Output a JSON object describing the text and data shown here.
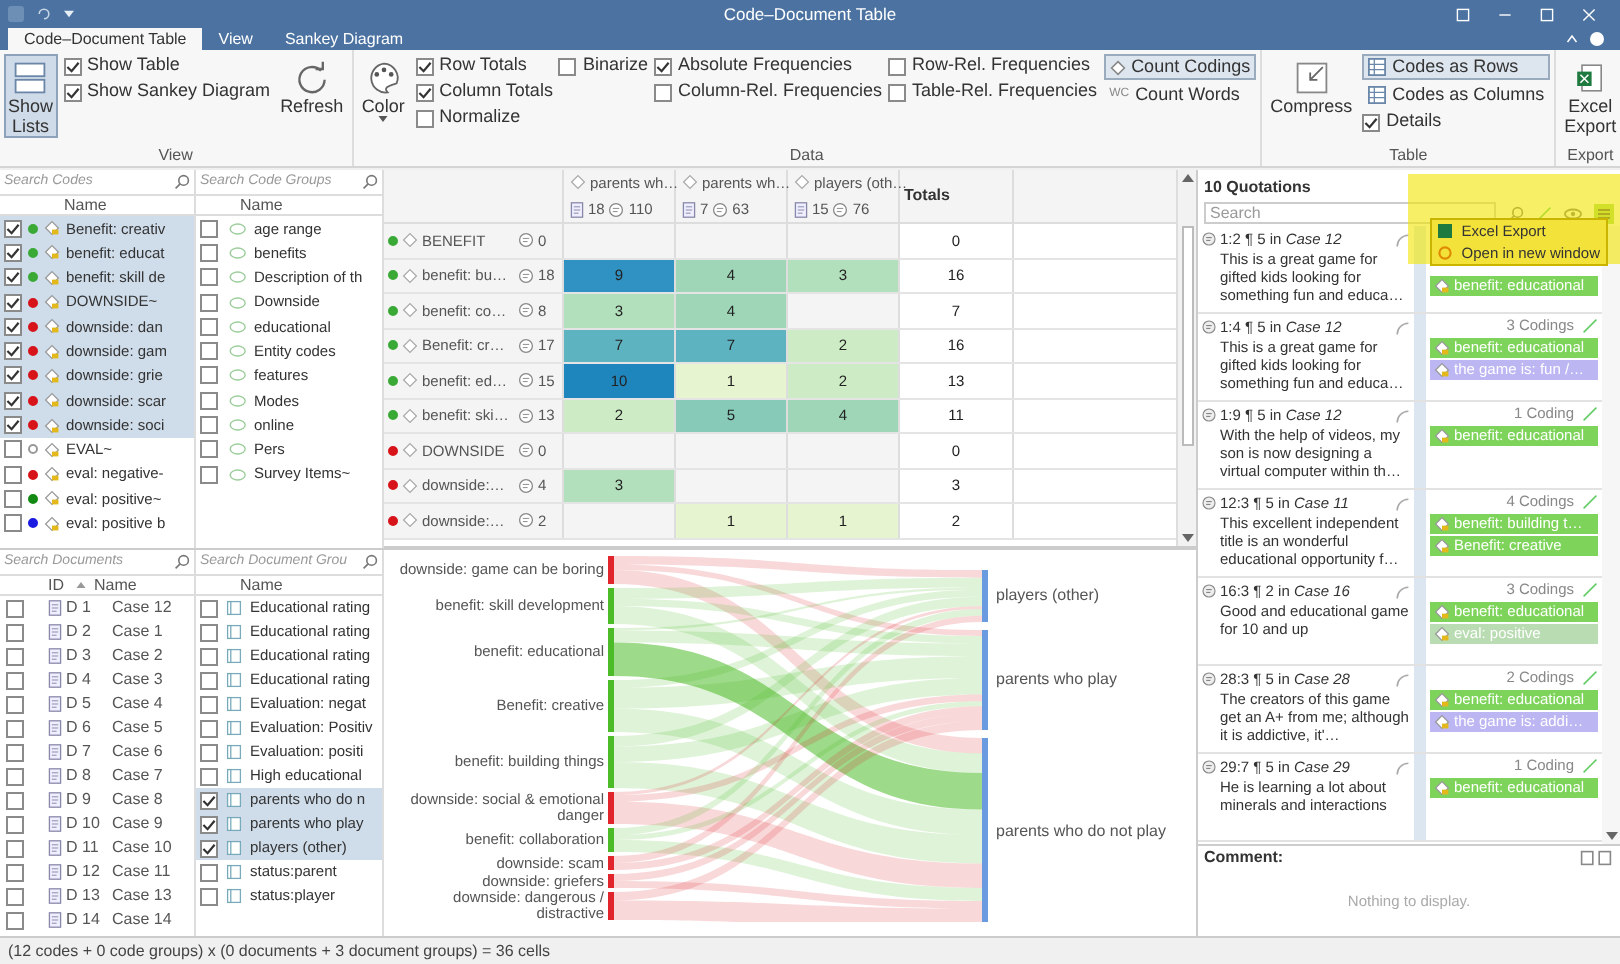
{
  "window": {
    "title": "Code–Document Table"
  },
  "tabs": [
    {
      "label": "Code–Document Table",
      "selected": true
    },
    {
      "label": "View",
      "selected": false
    },
    {
      "label": "Sankey Diagram",
      "selected": false
    }
  ],
  "ribbon": [
    {
      "label": "View",
      "columns": [
        [
          {
            "kind": "lists",
            "label": "Show Lists",
            "selected": true
          }
        ],
        [
          {
            "kind": "check",
            "label": "Show Table",
            "checked": true
          },
          {
            "kind": "check",
            "label": "Show Sankey Diagram",
            "checked": true
          }
        ],
        [
          {
            "kind": "refresh",
            "label": "Refresh"
          }
        ]
      ]
    },
    {
      "label": "Data",
      "columns": [
        [
          {
            "kind": "color",
            "label": "Color"
          }
        ],
        [
          {
            "kind": "check",
            "label": "Row Totals",
            "checked": true
          },
          {
            "kind": "check",
            "label": "Column Totals",
            "checked": true
          },
          {
            "kind": "check",
            "label": "Normalize",
            "checked": false
          }
        ],
        [
          {
            "kind": "check",
            "label": "Binarize",
            "checked": false
          }
        ],
        [
          {
            "kind": "check",
            "label": "Absolute Frequencies",
            "checked": true
          },
          {
            "kind": "check",
            "label": "Column-Rel. Frequencies",
            "checked": false
          }
        ],
        [
          {
            "kind": "check",
            "label": "Row-Rel. Frequencies",
            "checked": false
          },
          {
            "kind": "check",
            "label": "Table-Rel. Frequencies",
            "checked": false
          }
        ],
        [
          {
            "kind": "codings",
            "label": "Count Codings",
            "selected": true
          },
          {
            "kind": "words",
            "label": "Count Words",
            "badge": "WC",
            "selected": false
          }
        ]
      ]
    },
    {
      "label": "Table",
      "columns": [
        [
          {
            "kind": "compress",
            "label": "Compress"
          }
        ],
        [
          {
            "kind": "rows",
            "label": "Codes as Rows",
            "selected": true
          },
          {
            "kind": "columns",
            "label": "Codes as Columns",
            "selected": false
          },
          {
            "kind": "check",
            "label": "Details",
            "checked": true
          }
        ]
      ]
    },
    {
      "label": "Export",
      "columns": [
        [
          {
            "kind": "excel",
            "label": "Excel Export"
          }
        ]
      ]
    }
  ],
  "codes": {
    "search_placeholder": "Search Codes",
    "column": "Name",
    "items": [
      {
        "checked": true,
        "selected": true,
        "color": "#3aa935",
        "name": "Benefit: creativ"
      },
      {
        "checked": true,
        "selected": true,
        "color": "#3aa935",
        "name": "benefit: educat"
      },
      {
        "checked": true,
        "selected": true,
        "color": "#3aa935",
        "name": "benefit: skill de"
      },
      {
        "checked": true,
        "selected": true,
        "color": "#d7141a",
        "name": "DOWNSIDE~"
      },
      {
        "checked": true,
        "selected": true,
        "color": "#d7141a",
        "name": "downside: dan"
      },
      {
        "checked": true,
        "selected": true,
        "color": "#d7141a",
        "name": "downside: gam"
      },
      {
        "checked": true,
        "selected": true,
        "color": "#d7141a",
        "name": "downside: grie"
      },
      {
        "checked": true,
        "selected": true,
        "color": "#d7141a",
        "name": "downside: scar"
      },
      {
        "checked": true,
        "selected": true,
        "color": "#d7141a",
        "name": "downside: soci"
      },
      {
        "checked": false,
        "selected": false,
        "color": "#ffffff",
        "name": "EVAL~"
      },
      {
        "checked": false,
        "selected": false,
        "color": "#d7141a",
        "name": "eval: negative-"
      },
      {
        "checked": false,
        "selected": false,
        "color": "#138a13",
        "name": "eval: positive~"
      },
      {
        "checked": false,
        "selected": false,
        "color": "#1a1ae0",
        "name": "eval: positive b"
      }
    ]
  },
  "code_groups": {
    "search_placeholder": "Search Code Groups",
    "column": "Name",
    "items": [
      {
        "checked": false,
        "name": "age range"
      },
      {
        "checked": false,
        "name": "benefits"
      },
      {
        "checked": false,
        "name": "Description of th"
      },
      {
        "checked": false,
        "name": "Downside"
      },
      {
        "checked": false,
        "name": "educational"
      },
      {
        "checked": false,
        "name": "Entity codes"
      },
      {
        "checked": false,
        "name": "features"
      },
      {
        "checked": false,
        "name": "Modes"
      },
      {
        "checked": false,
        "name": "online"
      },
      {
        "checked": false,
        "name": "Pers"
      },
      {
        "checked": false,
        "name": "Survey Items~"
      }
    ]
  },
  "matrix": {
    "columns": [
      {
        "name": "parents wh…",
        "documents": "18",
        "quotations": "110"
      },
      {
        "name": "parents wh…",
        "documents": "7",
        "quotations": "63"
      },
      {
        "name": "players (oth…",
        "documents": "15",
        "quotations": "76"
      }
    ],
    "totals_label": "Totals",
    "rows": [
      {
        "color": "#3aa935",
        "name": "BENEFIT",
        "count": "0",
        "cells": [
          null,
          null,
          null
        ],
        "total": "0"
      },
      {
        "color": "#3aa935",
        "name": "benefit: bu…",
        "count": "18",
        "cells": [
          "9",
          "4",
          "3"
        ],
        "total": "16"
      },
      {
        "color": "#3aa935",
        "name": "benefit: co…",
        "count": "8",
        "cells": [
          "3",
          "4",
          null
        ],
        "total": "7"
      },
      {
        "color": "#3aa935",
        "name": "Benefit: cr…",
        "count": "17",
        "cells": [
          "7",
          "7",
          "2"
        ],
        "total": "16"
      },
      {
        "color": "#3aa935",
        "name": "benefit: ed…",
        "count": "15",
        "cells": [
          "10",
          "1",
          "2"
        ],
        "total": "13"
      },
      {
        "color": "#3aa935",
        "name": "benefit: ski…",
        "count": "13",
        "cells": [
          "2",
          "5",
          "4"
        ],
        "total": "11"
      },
      {
        "color": "#d7141a",
        "name": "DOWNSIDE",
        "count": "0",
        "cells": [
          null,
          null,
          null
        ],
        "total": "0"
      },
      {
        "color": "#d7141a",
        "name": "downside:…",
        "count": "4",
        "cells": [
          "3",
          null,
          null
        ],
        "total": "3"
      },
      {
        "color": "#d7141a",
        "name": "downside:…",
        "count": "2",
        "cells": [
          null,
          "1",
          "1"
        ],
        "total": "2"
      }
    ]
  },
  "documents": {
    "search_placeholder": "Search Documents",
    "columns": [
      "ID",
      "Name"
    ],
    "items": [
      {
        "checked": false,
        "id": "D 1",
        "name": "Case 12"
      },
      {
        "checked": false,
        "id": "D 2",
        "name": "Case 1"
      },
      {
        "checked": false,
        "id": "D 3",
        "name": "Case 2"
      },
      {
        "checked": false,
        "id": "D 4",
        "name": "Case 3"
      },
      {
        "checked": false,
        "id": "D 5",
        "name": "Case 4"
      },
      {
        "checked": false,
        "id": "D 6",
        "name": "Case 5"
      },
      {
        "checked": false,
        "id": "D 7",
        "name": "Case 6"
      },
      {
        "checked": false,
        "id": "D 8",
        "name": "Case 7"
      },
      {
        "checked": false,
        "id": "D 9",
        "name": "Case 8"
      },
      {
        "checked": false,
        "id": "D 10",
        "name": "Case 9"
      },
      {
        "checked": false,
        "id": "D 11",
        "name": "Case 10"
      },
      {
        "checked": false,
        "id": "D 12",
        "name": "Case 11"
      },
      {
        "checked": false,
        "id": "D 13",
        "name": "Case 13"
      },
      {
        "checked": false,
        "id": "D 14",
        "name": "Case 14"
      }
    ]
  },
  "document_groups": {
    "search_placeholder": "Search Document Grou",
    "column": "Name",
    "items": [
      {
        "checked": false,
        "selected": false,
        "name": "Educational rating"
      },
      {
        "checked": false,
        "selected": false,
        "name": "Educational rating"
      },
      {
        "checked": false,
        "selected": false,
        "name": "Educational rating"
      },
      {
        "checked": false,
        "selected": false,
        "name": "Educational rating"
      },
      {
        "checked": false,
        "selected": false,
        "name": "Evaluation: negat"
      },
      {
        "checked": false,
        "selected": false,
        "name": "Evaluation: Positiv"
      },
      {
        "checked": false,
        "selected": false,
        "name": "Evaluation: positi"
      },
      {
        "checked": false,
        "selected": false,
        "name": "High educational"
      },
      {
        "checked": true,
        "selected": true,
        "name": "parents who do n"
      },
      {
        "checked": true,
        "selected": true,
        "name": "parents who play"
      },
      {
        "checked": true,
        "selected": true,
        "name": "players (other)"
      },
      {
        "checked": false,
        "selected": false,
        "name": "status:parent"
      },
      {
        "checked": false,
        "selected": false,
        "name": "status:player"
      }
    ]
  },
  "sankey": {
    "sources": [
      {
        "label": "downside: game can be boring",
        "color": "#e0262c"
      },
      {
        "label": "benefit: skill development",
        "color": "#4cbb28"
      },
      {
        "label": "benefit: educational",
        "color": "#4cbb28"
      },
      {
        "label": "Benefit: creative",
        "color": "#4cbb28"
      },
      {
        "label": "benefit: building things",
        "color": "#4cbb28"
      },
      {
        "label": "downside: social & emotional danger",
        "color": "#e0262c"
      },
      {
        "label": "benefit: collaboration",
        "color": "#4cbb28"
      },
      {
        "label": "downside: scam",
        "color": "#e0262c"
      },
      {
        "label": "downside: griefers",
        "color": "#e0262c"
      },
      {
        "label": "downside: dangerous / distractive",
        "color": "#e0262c"
      }
    ],
    "targets": [
      {
        "label": "players (other)",
        "color": "#6a9be0"
      },
      {
        "label": "parents who play",
        "color": "#6a9be0"
      },
      {
        "label": "parents who do not play",
        "color": "#6a9be0"
      }
    ]
  },
  "quotations": {
    "title": "10 Quotations",
    "search_placeholder": "Search",
    "items": [
      {
        "heading": "1:2 ¶ 5 in *Case 12*",
        "text": "This is a great game for gifted kids looking for something fun and educa…",
        "tags": [
          {
            "name": "benefit: educational",
            "color": "#7ed45a"
          }
        ]
      },
      {
        "heading": "1:4 ¶ 5 in *Case 12*",
        "text": "This is a great game for gifted kids looking for something fun and educa…",
        "codings": "3 Codings",
        "tags": [
          {
            "name": "benefit: educational",
            "color": "#7ed45a"
          },
          {
            "name": "the game is: fun /…",
            "color": "#bcb6f2"
          }
        ]
      },
      {
        "heading": "1:9 ¶ 5 in *Case 12*",
        "text": "With the help of videos, my son is now designing a virtual computer within th…",
        "codings": "1 Coding",
        "tags": [
          {
            "name": "benefit: educational",
            "color": "#7ed45a"
          }
        ]
      },
      {
        "heading": "12:3 ¶ 5 in *Case 11*",
        "text": "This excellent independent title is an wonderful educational opportunity f…",
        "codings": "4 Codings",
        "tags": [
          {
            "name": "benefit: building t…",
            "color": "#7ed45a"
          },
          {
            "name": "Benefit: creative",
            "color": "#7ed45a"
          }
        ]
      },
      {
        "heading": "16:3 ¶ 2 in *Case 16*",
        "text": "Good and educational game for 10 and up",
        "codings": "3 Codings",
        "tags": [
          {
            "name": "benefit: educational",
            "color": "#7ed45a"
          },
          {
            "name": "eval: positive",
            "color": "#b9dcb2"
          }
        ]
      },
      {
        "heading": "28:3 ¶ 5 in *Case 28*",
        "text": "The creators of this game get an A+ from me; although it is addictive, it'…",
        "codings": "2 Codings",
        "tags": [
          {
            "name": "benefit: educational",
            "color": "#7ed45a"
          },
          {
            "name": "the game is: addi…",
            "color": "#bcb6f2"
          }
        ]
      },
      {
        "heading": "29:7 ¶ 5 in *Case 29*",
        "text": "He is learning a lot about minerals and interactions",
        "codings": "1 Coding",
        "tags": [
          {
            "name": "benefit: educational",
            "color": "#7ed45a"
          }
        ]
      }
    ],
    "menu": [
      {
        "kind": "excel",
        "label": "Excel Export"
      },
      {
        "kind": "window",
        "label": "Open in new window"
      }
    ],
    "comment_label": "Comment:",
    "comment_empty": "Nothing to display."
  },
  "status_bar": "(12 codes + 0 code groups) x (0 documents + 3 document groups) = 36 cells"
}
